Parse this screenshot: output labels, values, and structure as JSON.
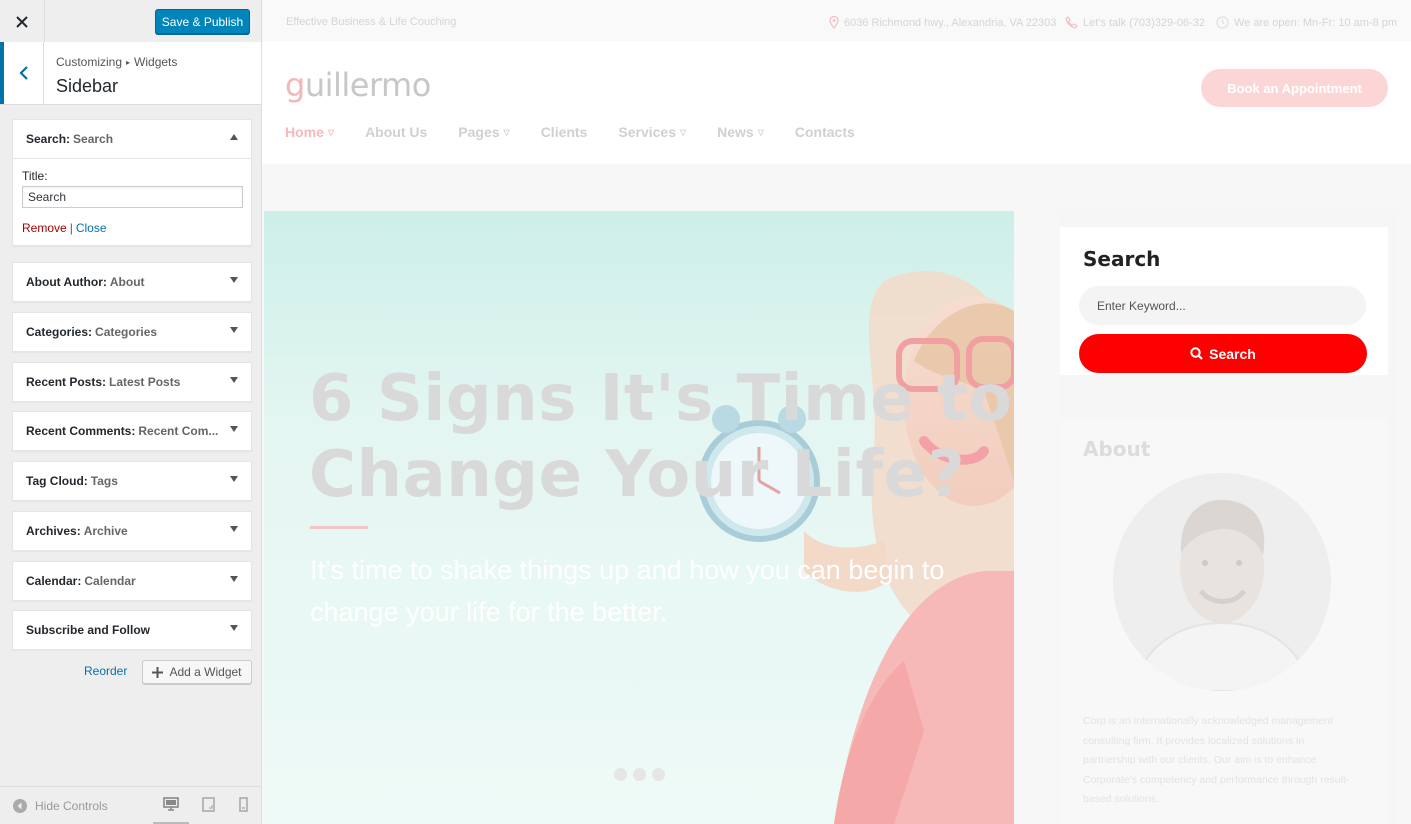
{
  "customizer": {
    "close_label": "Close",
    "publish_label": "Save & Publish",
    "breadcrumb": {
      "root": "Customizing",
      "current": "Widgets"
    },
    "section_title": "Sidebar",
    "widgets": [
      {
        "type": "Search",
        "title": "Search",
        "expanded": true
      },
      {
        "type": "About Author",
        "title": "About",
        "expanded": false
      },
      {
        "type": "Categories",
        "title": "Categories",
        "expanded": false
      },
      {
        "type": "Recent Posts",
        "title": "Latest Posts",
        "expanded": false
      },
      {
        "type": "Recent Comments",
        "title": "Recent Com...",
        "expanded": false
      },
      {
        "type": "Tag Cloud",
        "title": "Tags",
        "expanded": false
      },
      {
        "type": "Archives",
        "title": "Archive",
        "expanded": false
      },
      {
        "type": "Calendar",
        "title": "Calendar",
        "expanded": false
      },
      {
        "type": "Subscribe and Follow",
        "title": "",
        "expanded": false
      }
    ],
    "search_form": {
      "title_label": "Title:",
      "title_value": "Search",
      "remove": "Remove",
      "close": "Close",
      "separator": "|"
    },
    "reorder_label": "Reorder",
    "add_widget_label": "Add a Widget",
    "hide_controls_label": "Hide Controls",
    "accent": "#0085ba"
  },
  "preview": {
    "tagline": "Effective Business & Life Couching",
    "address": "6036 Richmond hwy., Alexandria, VA 22303",
    "phone": "Let's talk (703)329-06-32",
    "hours": "We are open: Mn-Fr: 10 am-8 pm",
    "logo_first": "g",
    "logo_rest": "uillermo",
    "appointment_label": "Book an Appointment",
    "nav": [
      {
        "label": "Home",
        "dropdown": true,
        "active": true
      },
      {
        "label": "About Us",
        "dropdown": false
      },
      {
        "label": "Pages",
        "dropdown": true
      },
      {
        "label": "Clients",
        "dropdown": false
      },
      {
        "label": "Services",
        "dropdown": true
      },
      {
        "label": "News",
        "dropdown": true
      },
      {
        "label": "Contacts",
        "dropdown": false
      }
    ],
    "hero": {
      "title_line1": "6 Signs It's Time to",
      "title_line2": "Change Your Life?",
      "subtitle": "It’s time to shake things up and how you can begin to change your life for the better."
    },
    "search_widget": {
      "heading": "Search",
      "placeholder": "Enter Keyword...",
      "button": "Search"
    },
    "about_widget": {
      "heading": "About",
      "text": "Corp is an internationally acknowledged management consulting firm. It provides localized solutions in partnership with our clients. Our aim is to enhance Corporate's competency and performance through result-based solutions."
    },
    "brand_red": "#ff0000"
  }
}
